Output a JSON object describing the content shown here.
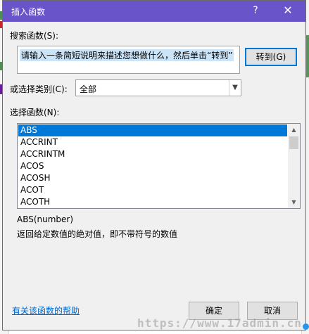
{
  "dialog": {
    "title": "插入函数",
    "help_glyph": "?",
    "close_glyph": "✕",
    "search_label": "搜索函数(S):",
    "search_value": "请输入一条简短说明来描述您想做什么，然后单击“转到”",
    "goto_label": "转到(G)",
    "category_label": "或选择类别(C):",
    "category_value": "全部",
    "function_list_label": "选择函数(N):",
    "functions": [
      "ABS",
      "ACCRINT",
      "ACCRINTM",
      "ACOS",
      "ACOSH",
      "ACOT",
      "ACOTH"
    ],
    "selected_function": "ABS",
    "syntax": "ABS(number)",
    "description": "返回给定数值的绝对值，即不带符号的数值",
    "help_link": "有关该函数的帮助",
    "ok_label": "确定",
    "cancel_label": "取消"
  },
  "icons": {
    "scroll_up": "up-arrow-icon",
    "scroll_down": "down-arrow-icon",
    "dropdown": "chevron-down-icon"
  },
  "colors": {
    "titlebar": "#6a54c9",
    "selection": "#0078d7",
    "link": "#0066cc"
  },
  "watermark": "https://www.17admin.cn"
}
